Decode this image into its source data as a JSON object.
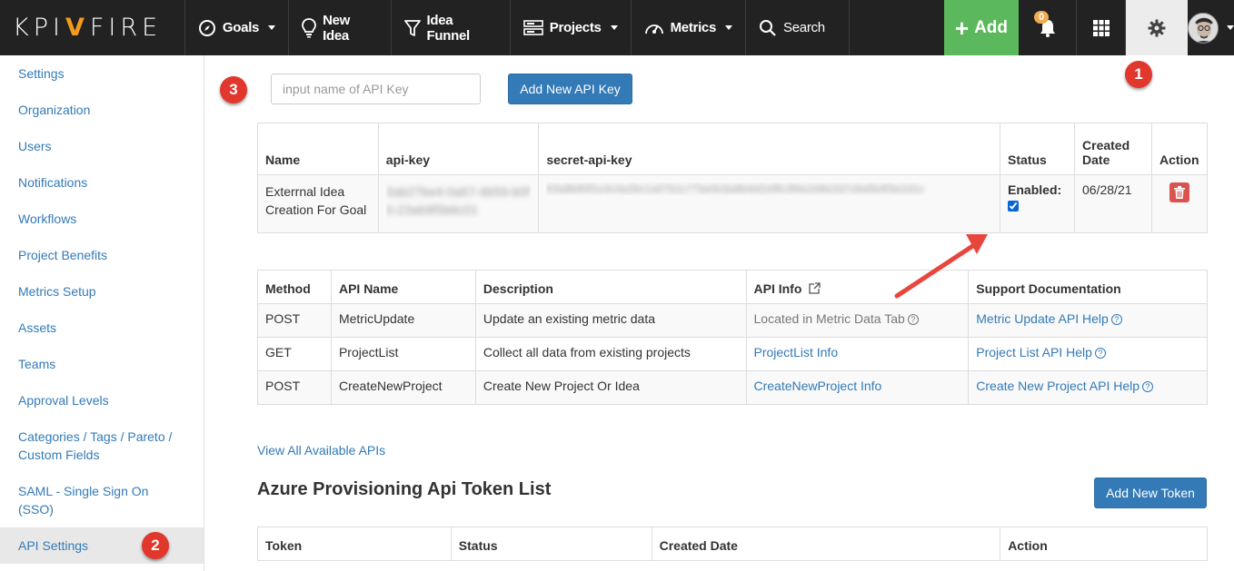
{
  "nav": {
    "logo": {
      "left": "KPI",
      "mark": "V",
      "right": "FIRE"
    },
    "goals": "Goals",
    "new_idea": "New Idea",
    "idea_funnel": "Idea Funnel",
    "projects": "Projects",
    "metrics": "Metrics",
    "search": "Search",
    "add": "Add",
    "notifications_count": "0"
  },
  "sidebar": {
    "items": [
      {
        "label": "Settings"
      },
      {
        "label": "Organization"
      },
      {
        "label": "Users"
      },
      {
        "label": "Notifications"
      },
      {
        "label": "Workflows"
      },
      {
        "label": "Project Benefits"
      },
      {
        "label": "Metrics Setup"
      },
      {
        "label": "Assets"
      },
      {
        "label": "Teams"
      },
      {
        "label": "Approval Levels"
      },
      {
        "label": "Categories / Tags / Pareto / Custom Fields"
      },
      {
        "label": "SAML - Single Sign On (SSO)"
      },
      {
        "label": "API Settings"
      }
    ]
  },
  "markers": {
    "one": "1",
    "two": "2",
    "three": "3"
  },
  "api_key_form": {
    "placeholder": "input name of API Key",
    "button": "Add New API Key"
  },
  "keys_table": {
    "headers": [
      "Name",
      "api-key",
      "secret-api-key",
      "Status",
      "Created Date",
      "Action"
    ],
    "row": {
      "name": "Exterrnal Idea Creation For Goal",
      "api_key": "3ab27be4-0a67-4b59-b0f0-23ab9f5b6c01",
      "secret_api_key": "63a8b90f1e4c4a2bc1a07b1c77be9c6a8b4d2e9fc3f4a1b8e2d7c6a5b4f3e2d1c",
      "status": "Enabled:",
      "created": "06/28/21"
    }
  },
  "apis_table": {
    "headers": [
      "Method",
      "API Name",
      "Description",
      "API Info",
      "Support Documentation"
    ],
    "rows": [
      {
        "method": "POST",
        "name": "MetricUpdate",
        "description": "Update an existing metric data",
        "info": "Located in Metric Data Tab",
        "docs": "Metric Update API Help"
      },
      {
        "method": "GET",
        "name": "ProjectList",
        "description": "Collect all data from existing projects",
        "info": "ProjectList Info",
        "docs": "Project List API Help"
      },
      {
        "method": "POST",
        "name": "CreateNewProject",
        "description": "Create New Project Or Idea",
        "info": "CreateNewProject Info",
        "docs": "Create New Project API Help"
      }
    ]
  },
  "view_all": "View All Available APIs",
  "azure": {
    "title": "Azure Provisioning Api Token List",
    "button": "Add New Token",
    "headers": [
      "Token",
      "Status",
      "Created Date",
      "Action"
    ]
  },
  "colors": {
    "accent": "#337ab7",
    "add_green": "#5cb85c",
    "marker_red": "#e2372c",
    "arrow_red": "#e8453c",
    "badge": "#f0ad4e"
  }
}
